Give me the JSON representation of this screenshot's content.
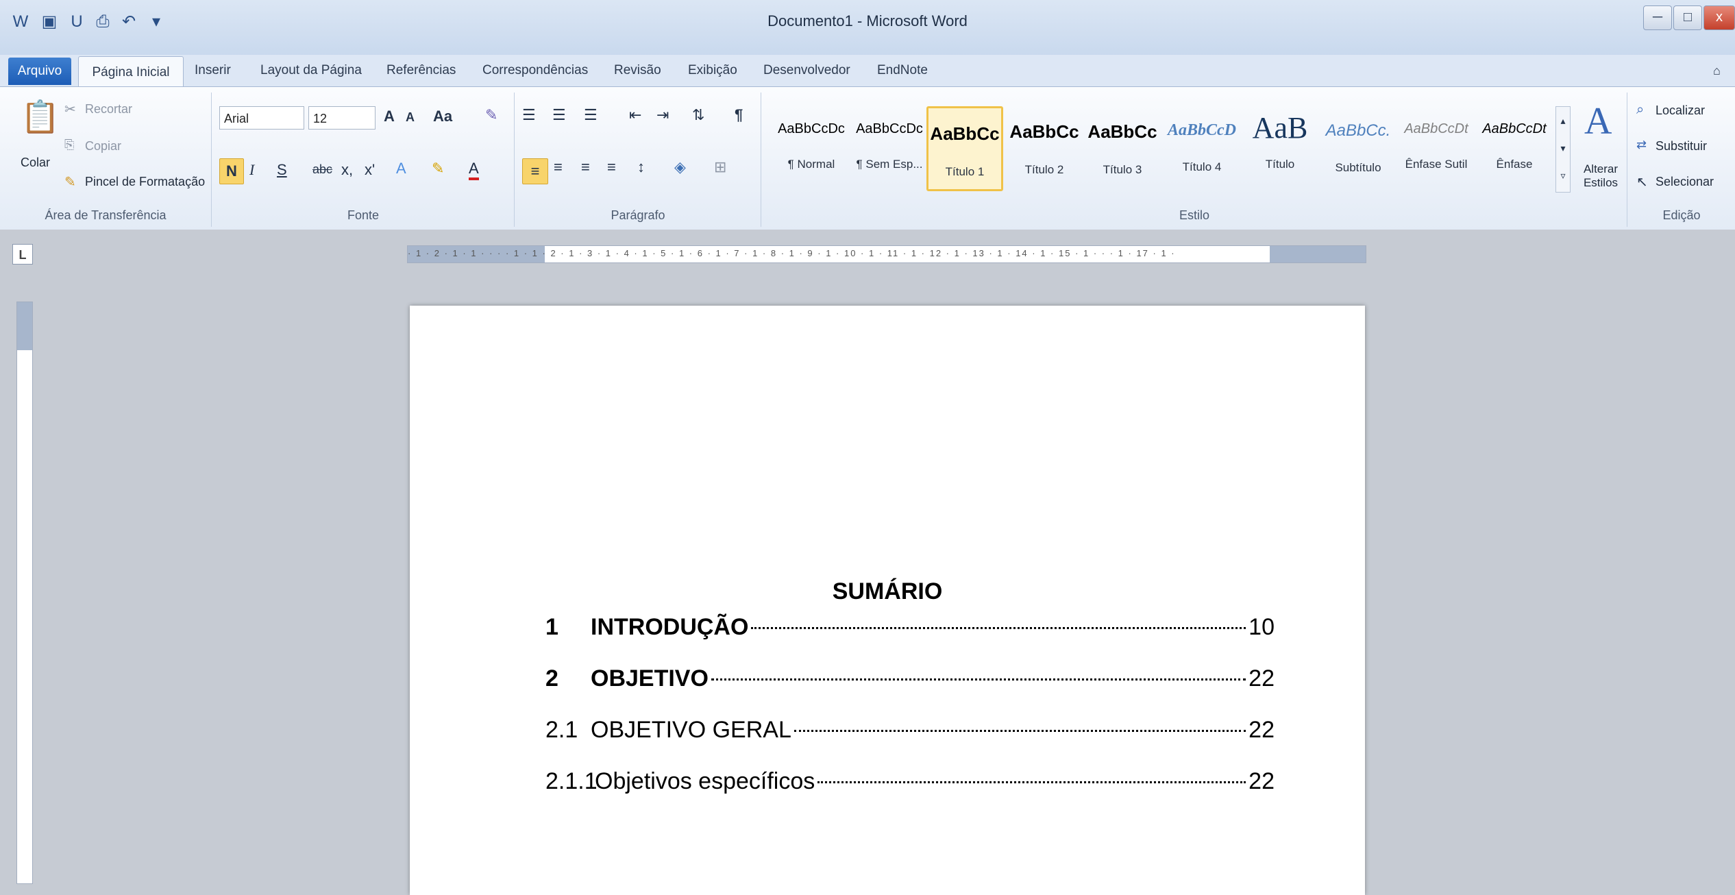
{
  "window": {
    "title": "Documento1 - Microsoft Word",
    "qat_icons": [
      "word-icon",
      "save-icon",
      "underline-u-icon",
      "print-preview-icon",
      "undo-icon",
      "customize-icon"
    ],
    "controls": {
      "minimize": "─",
      "restore": "□",
      "close": "x"
    }
  },
  "tabs": {
    "file": "Arquivo",
    "items": [
      "Página Inicial",
      "Inserir",
      "Layout da Página",
      "Referências",
      "Correspondências",
      "Revisão",
      "Exibição",
      "Desenvolvedor",
      "EndNote"
    ]
  },
  "clipboard": {
    "paste": "Colar",
    "cut": "Recortar",
    "copy": "Copiar",
    "format_painter": "Pincel de Formatação",
    "label": "Área de Transferência"
  },
  "font": {
    "family": "Arial",
    "size": "12",
    "bold": "N",
    "italic": "I",
    "underline": "S",
    "strike": "abc",
    "subscript": "x,",
    "superscript": "x'",
    "grow": "A",
    "shrink": "A",
    "change_case": "Aa",
    "label": "Fonte"
  },
  "paragraph": {
    "label": "Parágrafo",
    "pilcrow": "¶"
  },
  "styles": {
    "items": [
      {
        "sample": "AaBbCcDc",
        "name": "¶ Normal"
      },
      {
        "sample": "AaBbCcDc",
        "name": "¶ Sem Esp..."
      },
      {
        "sample": "AaBbCc",
        "name": "Título 1"
      },
      {
        "sample": "AaBbCc",
        "name": "Título 2"
      },
      {
        "sample": "AaBbCc",
        "name": "Título 3"
      },
      {
        "sample": "AaBbCcD",
        "name": "Título 4"
      },
      {
        "sample": "AaB",
        "name": "Título"
      },
      {
        "sample": "AaBbCc.",
        "name": "Subtítulo"
      },
      {
        "sample": "AaBbCcDt",
        "name": "Ênfase Sutil"
      },
      {
        "sample": "AaBbCcDt",
        "name": "Ênfase"
      }
    ],
    "change_styles": "Alterar Estilos",
    "label": "Estilo"
  },
  "editing": {
    "find": "Localizar",
    "replace": "Substituir",
    "select": "Selecionar",
    "label": "Edição"
  },
  "ruler": {
    "tab_selector": "L",
    "numbers": "· 1 · 2 · 1 · 1 · · · · 1 · 1 · 2 · 1 · 3 · 1 · 4 · 1 · 5 · 1 · 6 · 1 · 7 · 1 · 8 · 1 · 9 · 1 · 10 · 1 · 11 · 1 · 12 · 1 · 13 · 1 · 14 · 1 · 15 · 1 · · · 1 · 17 · 1 ·"
  },
  "document": {
    "toc_title": "SUMÁRIO",
    "toc": [
      {
        "num": "1",
        "text": "INTRODUÇÃO",
        "page": "10",
        "bold": true
      },
      {
        "num": "2",
        "text": "OBJETIVO",
        "page": "22",
        "bold": true
      },
      {
        "num": "2.1",
        "text": "OBJETIVO GERAL",
        "page": "22",
        "bold": false
      },
      {
        "num": "2.1.1",
        "text": "Objetivos específicos",
        "page": "22",
        "bold": false
      }
    ]
  }
}
